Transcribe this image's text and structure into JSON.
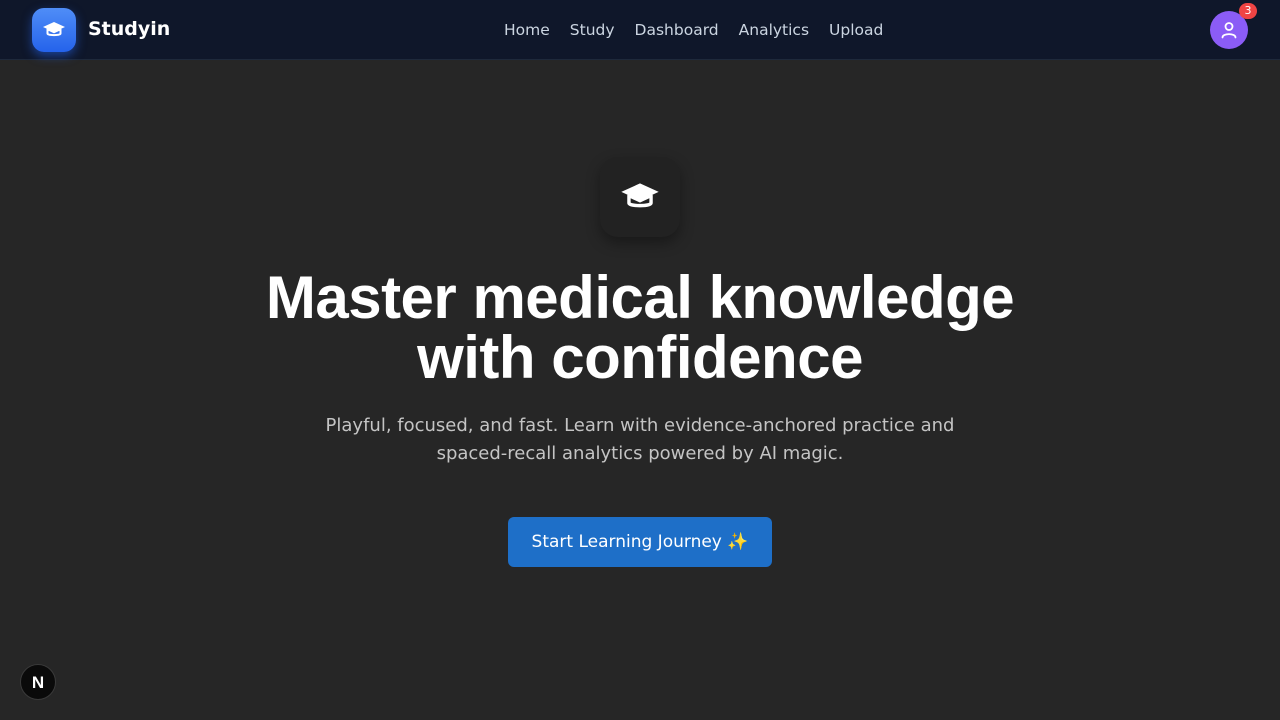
{
  "header": {
    "brand_name": "Studyin",
    "logo_icon": "graduation-cap-icon",
    "nav": [
      {
        "label": "Home"
      },
      {
        "label": "Study"
      },
      {
        "label": "Dashboard"
      },
      {
        "label": "Analytics"
      },
      {
        "label": "Upload"
      }
    ],
    "avatar_icon": "user-icon",
    "notification_count": "3"
  },
  "hero": {
    "icon": "graduation-cap-icon",
    "headline_line1": "Master medical knowledge",
    "headline_line2": "with confidence",
    "subtext_line1": "Playful, focused, and fast. Learn with evidence-anchored practice and",
    "subtext_line2": "spaced-recall analytics powered by AI magic.",
    "cta_label": "Start Learning Journey ✨"
  },
  "dev_badge": {
    "label": "N"
  },
  "colors": {
    "background": "#262626",
    "topbar": "#0f172a",
    "logo_gradient": "#3b82f6",
    "cta": "#1e6fc8",
    "avatar": "#8b5cf6",
    "badge": "#ef4444"
  }
}
